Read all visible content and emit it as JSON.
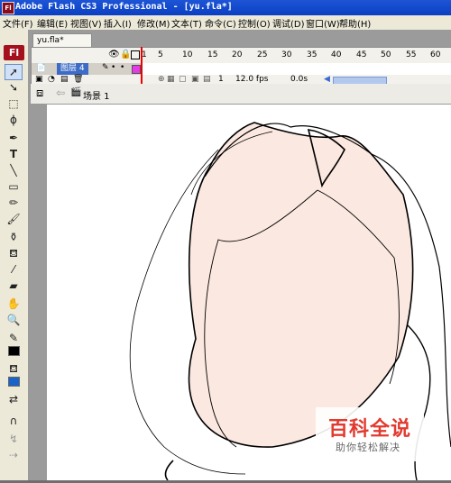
{
  "window": {
    "title": "Adobe Flash CS3 Professional - [yu.fla*]",
    "logo": "Fl"
  },
  "menu": [
    "文件(F)",
    "编辑(E)",
    "视图(V)",
    "插入(I)",
    "修改(M)",
    "文本(T)",
    "命令(C)",
    "控制(O)",
    "调试(D)",
    "窗口(W)",
    "帮助(H)"
  ],
  "doc_tab": "yu.fla*",
  "timeline": {
    "ruler": [
      "1",
      "5",
      "10",
      "15",
      "20",
      "25",
      "30",
      "35",
      "40",
      "45",
      "50",
      "55",
      "60"
    ],
    "layer_name": "图层 4",
    "current_frame": "1",
    "fps": "12.0 fps",
    "time": "0.0s"
  },
  "scene": {
    "label": "场景 1"
  },
  "toolbox_icons": [
    "selection-icon",
    "subselection-icon",
    "free-transform-icon",
    "lasso-icon",
    "pen-icon",
    "text-icon",
    "line-icon",
    "rectangle-icon",
    "pencil-icon",
    "brush-icon",
    "ink-bottle-icon",
    "paint-bucket-icon",
    "eyedropper-icon",
    "eraser-icon",
    "hand-icon",
    "zoom-icon",
    "stroke-color-icon",
    "fill-color-icon",
    "swap-colors-icon",
    "snap-icon"
  ],
  "watermark": {
    "title": "百科全说",
    "subtitle": "助你轻松解决"
  },
  "colors": {
    "face_fill": "#fbe8e0",
    "title_blue": "#0a3fc2",
    "watermark_red": "#e23a2f"
  }
}
